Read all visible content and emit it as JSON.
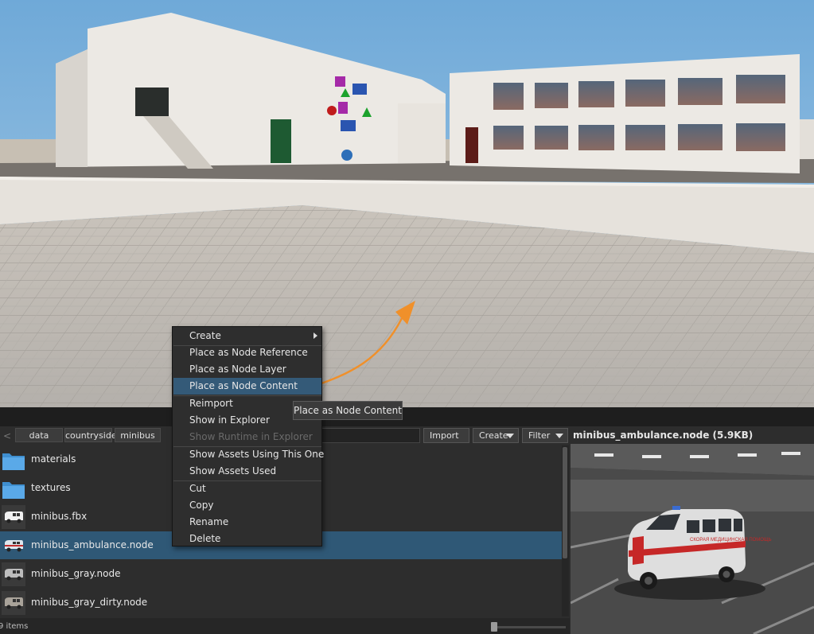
{
  "breadcrumbs": [
    "data",
    "countryside",
    "minibus"
  ],
  "search": {
    "value": ""
  },
  "toolbar": {
    "import_label": "Import",
    "create_label": "Create",
    "filter_label": "Filter"
  },
  "files": [
    {
      "name": "materials",
      "icon": "folder-icon",
      "selected": false
    },
    {
      "name": "textures",
      "icon": "folder-icon",
      "selected": false
    },
    {
      "name": "minibus.fbx",
      "icon": "minibus-icon",
      "selected": false
    },
    {
      "name": "minibus_ambulance.node",
      "icon": "minibus-icon",
      "selected": true
    },
    {
      "name": "minibus_gray.node",
      "icon": "minibus-icon",
      "selected": false
    },
    {
      "name": "minibus_gray_dirty.node",
      "icon": "minibus-icon",
      "selected": false
    }
  ],
  "status": {
    "items_count": "9 items"
  },
  "preview": {
    "title": "minibus_ambulance.node (5.9KB)",
    "vehicle_label": "СКОРАЯ МЕДИЦИНСКАЯ ПОМОЩЬ"
  },
  "context_menu": {
    "items": [
      {
        "label": "Create",
        "submenu": true
      },
      {
        "label": "Place as Node Reference"
      },
      {
        "label": "Place as Node Layer"
      },
      {
        "label": "Place as Node Content",
        "highlighted": true
      },
      {
        "label": "Reimport"
      },
      {
        "label": "Show in Explorer"
      },
      {
        "label": "Show Runtime in Explorer",
        "disabled": true
      },
      {
        "label": "Show Assets Using This One"
      },
      {
        "label": "Show Assets Used"
      },
      {
        "label": "Cut"
      },
      {
        "label": "Copy"
      },
      {
        "label": "Rename"
      },
      {
        "label": "Delete"
      }
    ]
  },
  "tooltip": {
    "text": "Place as Node Content"
  },
  "colors": {
    "selection": "#2f5876",
    "menu_highlight": "#345a78",
    "drag_arrow": "#f0902a"
  }
}
